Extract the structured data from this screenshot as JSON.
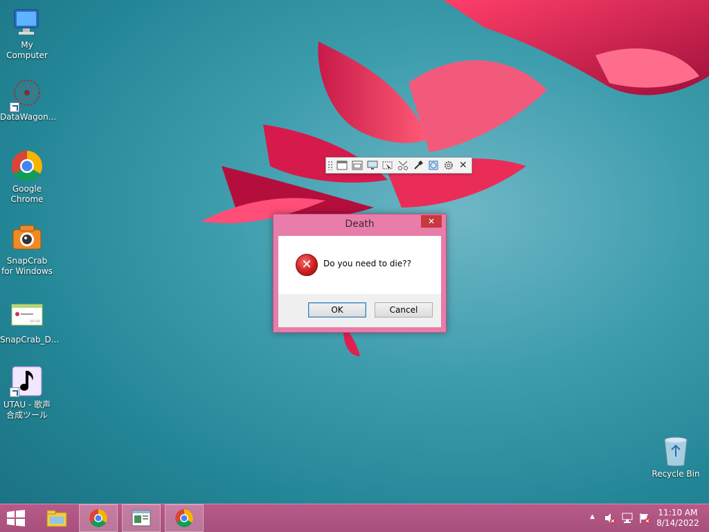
{
  "desktop": {
    "icons": [
      {
        "label": "My Computer"
      },
      {
        "label": "DataWagon..."
      },
      {
        "label": "Google Chrome"
      },
      {
        "label": "SnapCrab for Windows"
      },
      {
        "label": "SnapCrab_D..."
      },
      {
        "label": "UTAU - 歌声合成ツール"
      }
    ],
    "recycle_bin": {
      "label": "Recycle Bin"
    }
  },
  "toolbar": {
    "icons": [
      "grip-icon",
      "window-icon",
      "client-area-icon",
      "screen-icon",
      "region-icon",
      "web-capture-icon",
      "eyedropper-icon",
      "globe-icon",
      "gear-icon",
      "close-icon"
    ],
    "close_glyph": "✕"
  },
  "dialog": {
    "title": "Death",
    "close_glyph": "✕",
    "message": "Do you need to die??",
    "icon": "error-icon",
    "error_glyph": "✕",
    "ok_label": "OK",
    "cancel_label": "Cancel"
  },
  "taskbar": {
    "items": [
      "file-explorer-icon",
      "chrome-icon",
      "snapcrab-window-icon",
      "chrome-icon"
    ],
    "tray": {
      "icons": [
        "volume-muted-icon",
        "network-icon",
        "action-center-flag-icon"
      ],
      "time": "11:10 AM",
      "date": "8/14/2022",
      "overflow_glyph": "▲"
    }
  },
  "colors": {
    "accent": "#e87da9",
    "taskbar": "#b05584",
    "desktop": "#2a8c9c",
    "close_red": "#c7383f"
  }
}
